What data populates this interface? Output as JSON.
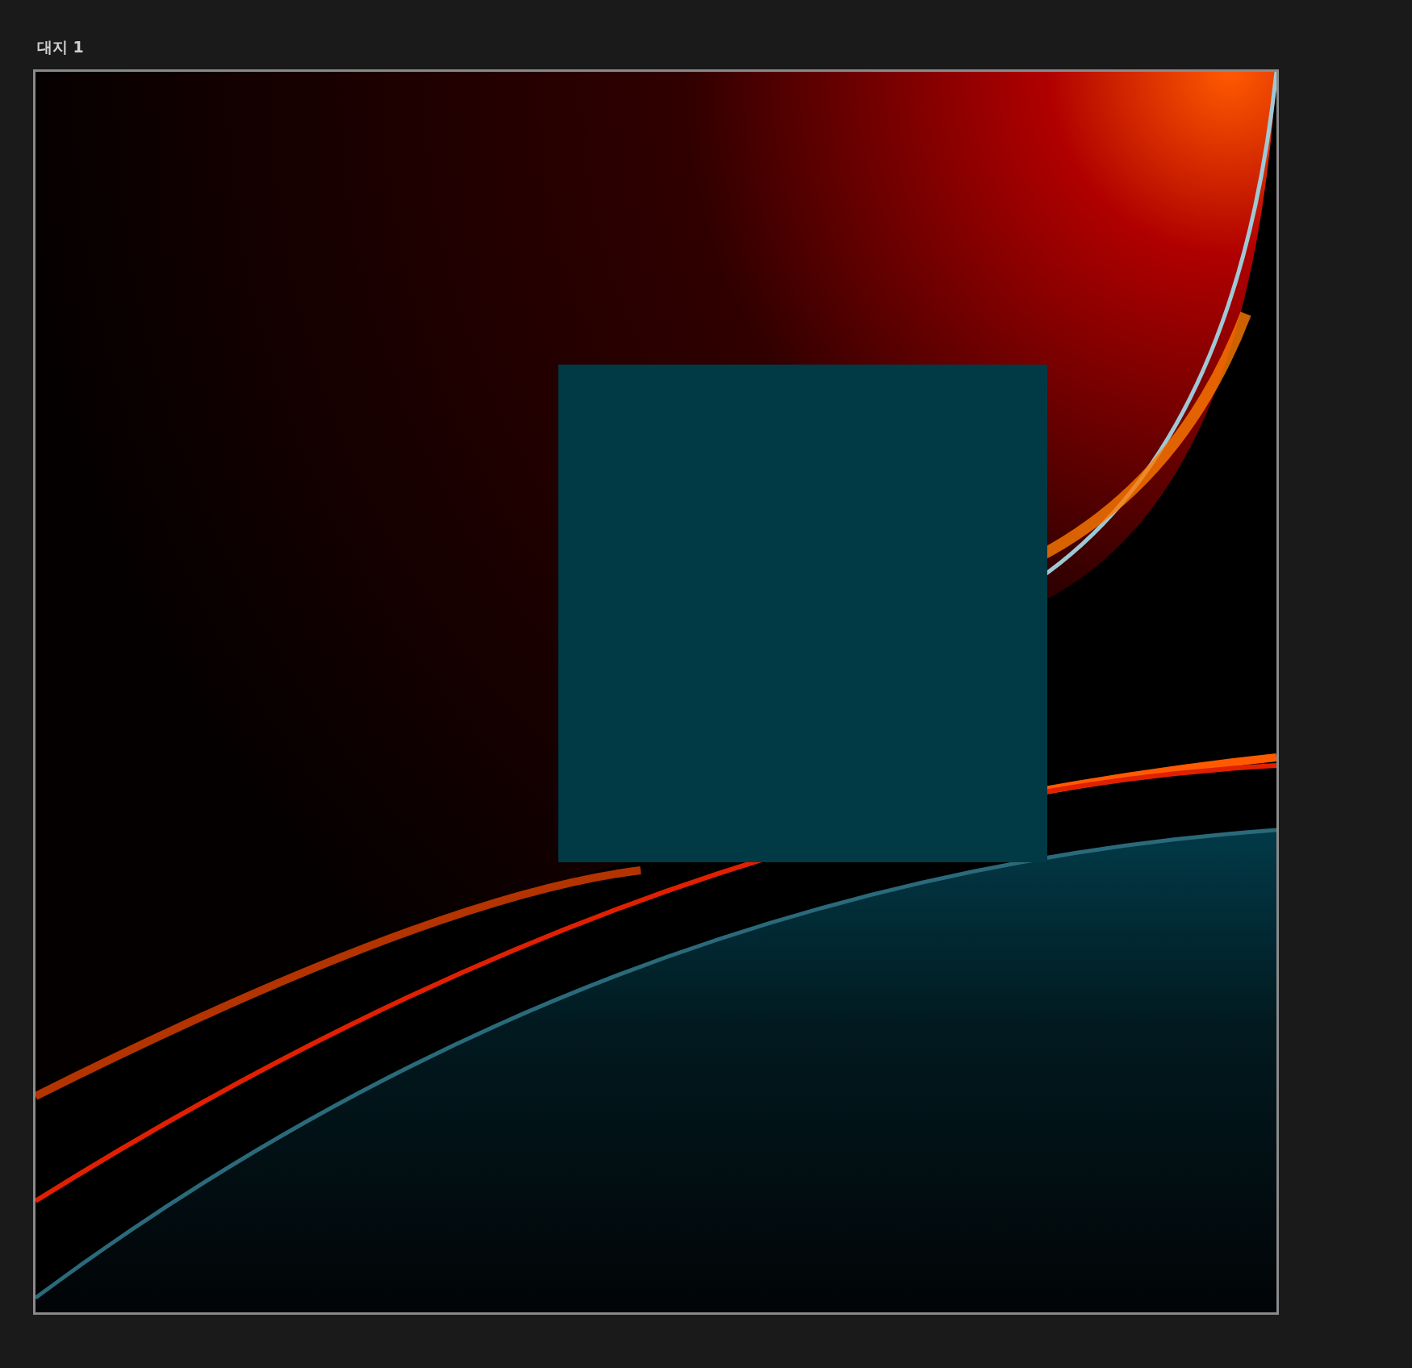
{
  "artboard": {
    "label": "대지 1"
  }
}
